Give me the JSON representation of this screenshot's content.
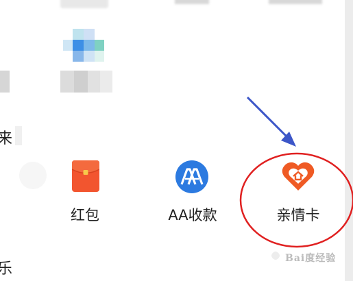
{
  "left_labels": {
    "upper_partial": "来",
    "lower_partial": "乐"
  },
  "actions": [
    {
      "label": "红包",
      "icon": "red-packet-icon"
    },
    {
      "label": "AA收款",
      "icon": "aa-collect-icon"
    },
    {
      "label": "亲情卡",
      "icon": "family-card-icon"
    }
  ],
  "colors": {
    "red_packet": "#f2552f",
    "aa_blue": "#2c7ae0",
    "family_orange": "#ef5a24",
    "annotation_red": "#e02020",
    "annotation_arrow": "#3c56c8"
  },
  "watermark": {
    "text": "Bai度经验"
  }
}
